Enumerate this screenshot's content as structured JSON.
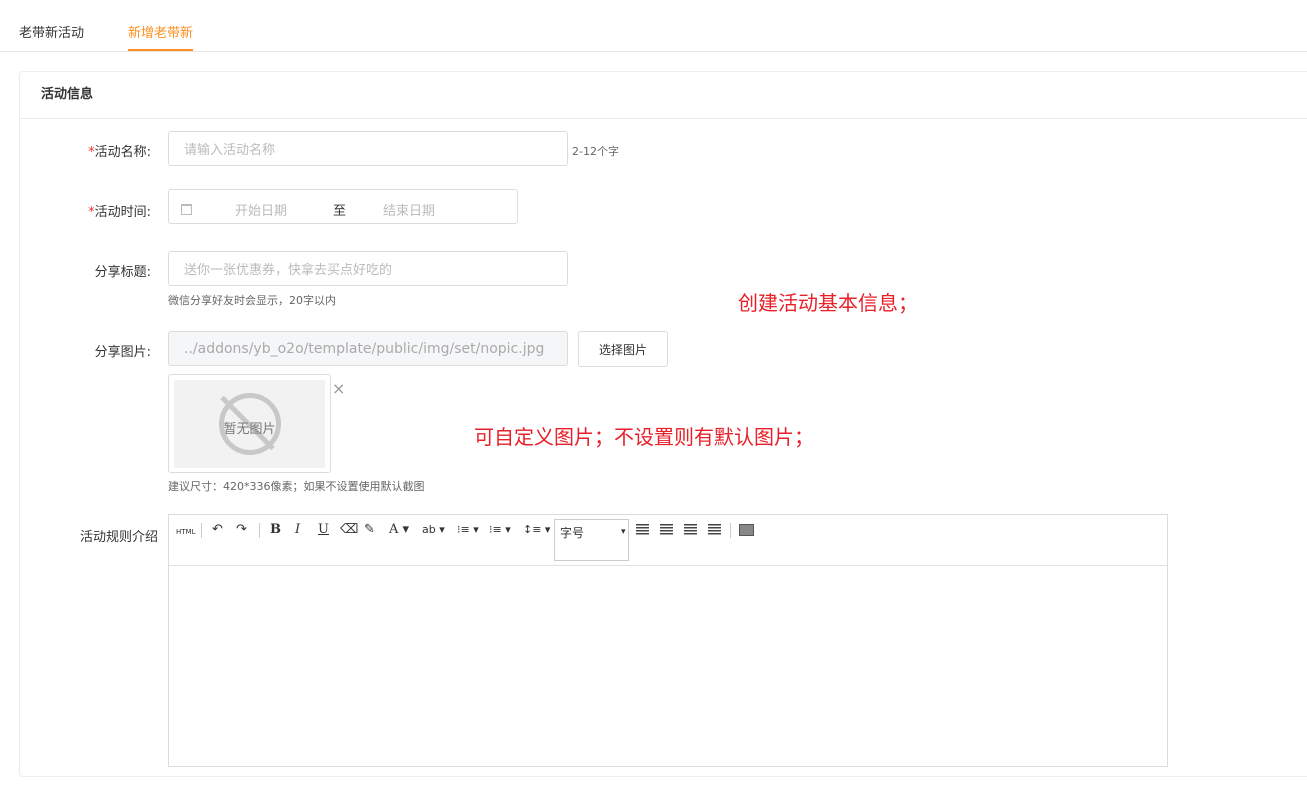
{
  "tabs": [
    {
      "label": "老带新活动"
    },
    {
      "label": "新增老带新"
    }
  ],
  "card": {
    "title": "活动信息"
  },
  "form": {
    "name": {
      "required": "*",
      "label": "活动名称:",
      "placeholder": "请输入活动名称",
      "hint": "2-12个字"
    },
    "time": {
      "required": "*",
      "label": "活动时间:",
      "start_placeholder": "开始日期",
      "separator": "至",
      "end_placeholder": "结束日期"
    },
    "share_title": {
      "label": "分享标题:",
      "placeholder": "送你一张优惠券，快拿去买点好吃的",
      "hint": "微信分享好友时会显示，20字以内"
    },
    "share_image": {
      "label": "分享图片:",
      "value": "../addons/yb_o2o/template/public/img/set/nopic.jpg",
      "button": "选择图片",
      "no_image_text": "暂无图片",
      "close_glyph": "×",
      "hint": "建议尺寸：420*336像素；如果不设置使用默认截图"
    },
    "rules": {
      "label": "活动规则介绍"
    }
  },
  "editor": {
    "toolbar": {
      "html": "HTML",
      "undo": "↶",
      "redo": "↷",
      "bold": "B",
      "italic": "I",
      "underline": "U",
      "eraser": "⌫",
      "brush": "✎",
      "fontcolor": "A ▾",
      "backcolor": "ab ▾",
      "ol": "⁝≡ ▾",
      "ul": "⁝≡ ▾",
      "lineheight": "↕≡ ▾",
      "fontsize": "字号",
      "fontsize_arrow": "▾"
    }
  },
  "annotations": {
    "a1": "创建活动基本信息；",
    "a2": "可自定义图片；不设置则有默认图片；"
  },
  "colors": {
    "accent": "#ff8f1f",
    "required": "#e33333",
    "annotation": "#e8202a"
  }
}
